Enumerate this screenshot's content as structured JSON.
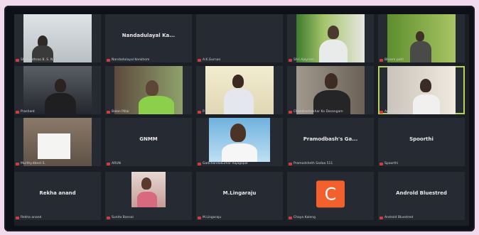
{
  "participants": [
    {
      "name": "Shrikanthrao B. S. N.",
      "big": "",
      "row": 0,
      "col": 0,
      "video": "office"
    },
    {
      "name": "Nandadulayal Kenkhom",
      "big": "Nandadulayal Ka...",
      "row": 0,
      "col": 1,
      "video": ""
    },
    {
      "name": "A.K.Gurnan",
      "big": "",
      "row": 0,
      "col": 2,
      "video": ""
    },
    {
      "name": "Shri.Ajayram",
      "big": "",
      "row": 0,
      "col": 3,
      "video": "outdoor"
    },
    {
      "name": "Bhasm patil",
      "big": "",
      "row": 0,
      "col": 4,
      "video": "plant"
    },
    {
      "name": "Prashant",
      "big": "",
      "row": 1,
      "col": 0,
      "video": "dark"
    },
    {
      "name": "Balan Pillai",
      "big": "",
      "row": 1,
      "col": 1,
      "video": "green"
    },
    {
      "name": "P.M.Dhumal",
      "big": "",
      "row": 1,
      "col": 2,
      "video": "cream"
    },
    {
      "name": "Chandrashekhar Ko Dasangam",
      "big": "",
      "row": 1,
      "col": 3,
      "video": "room"
    },
    {
      "name": "Anuradha",
      "big": "",
      "row": 1,
      "col": 4,
      "video": "woman",
      "active": true
    },
    {
      "name": "Murthy.dbest S.",
      "big": "",
      "row": 2,
      "col": 0,
      "video": "paper"
    },
    {
      "name": "ARUN",
      "big": "GNMM",
      "row": 2,
      "col": 1,
      "video": ""
    },
    {
      "name": "Gadchandakumar Rajagopal",
      "big": "",
      "row": 2,
      "col": 2,
      "video": "portrait"
    },
    {
      "name": "Pramodsheth Sadaa 511",
      "big": "Pramodbash's Ga...",
      "row": 2,
      "col": 3,
      "video": ""
    },
    {
      "name": "Spoorthi",
      "big": "Spoorthi",
      "row": 2,
      "col": 4,
      "video": ""
    },
    {
      "name": "Rekha anand",
      "big": "Rekha anand",
      "row": 3,
      "col": 0,
      "video": ""
    },
    {
      "name": "Sunita Bansal",
      "big": "",
      "row": 3,
      "col": 1,
      "video": "girl"
    },
    {
      "name": "M.Lingaraju",
      "big": "M.Lingaraju",
      "row": 3,
      "col": 2,
      "video": ""
    },
    {
      "name": "Chaya Kaleng",
      "big": "",
      "row": 3,
      "col": 3,
      "video": "avatar",
      "initial": "C"
    },
    {
      "name": "Androld Bluestred",
      "big": "Androld Bluestred",
      "row": 3,
      "col": 4,
      "video": ""
    }
  ]
}
